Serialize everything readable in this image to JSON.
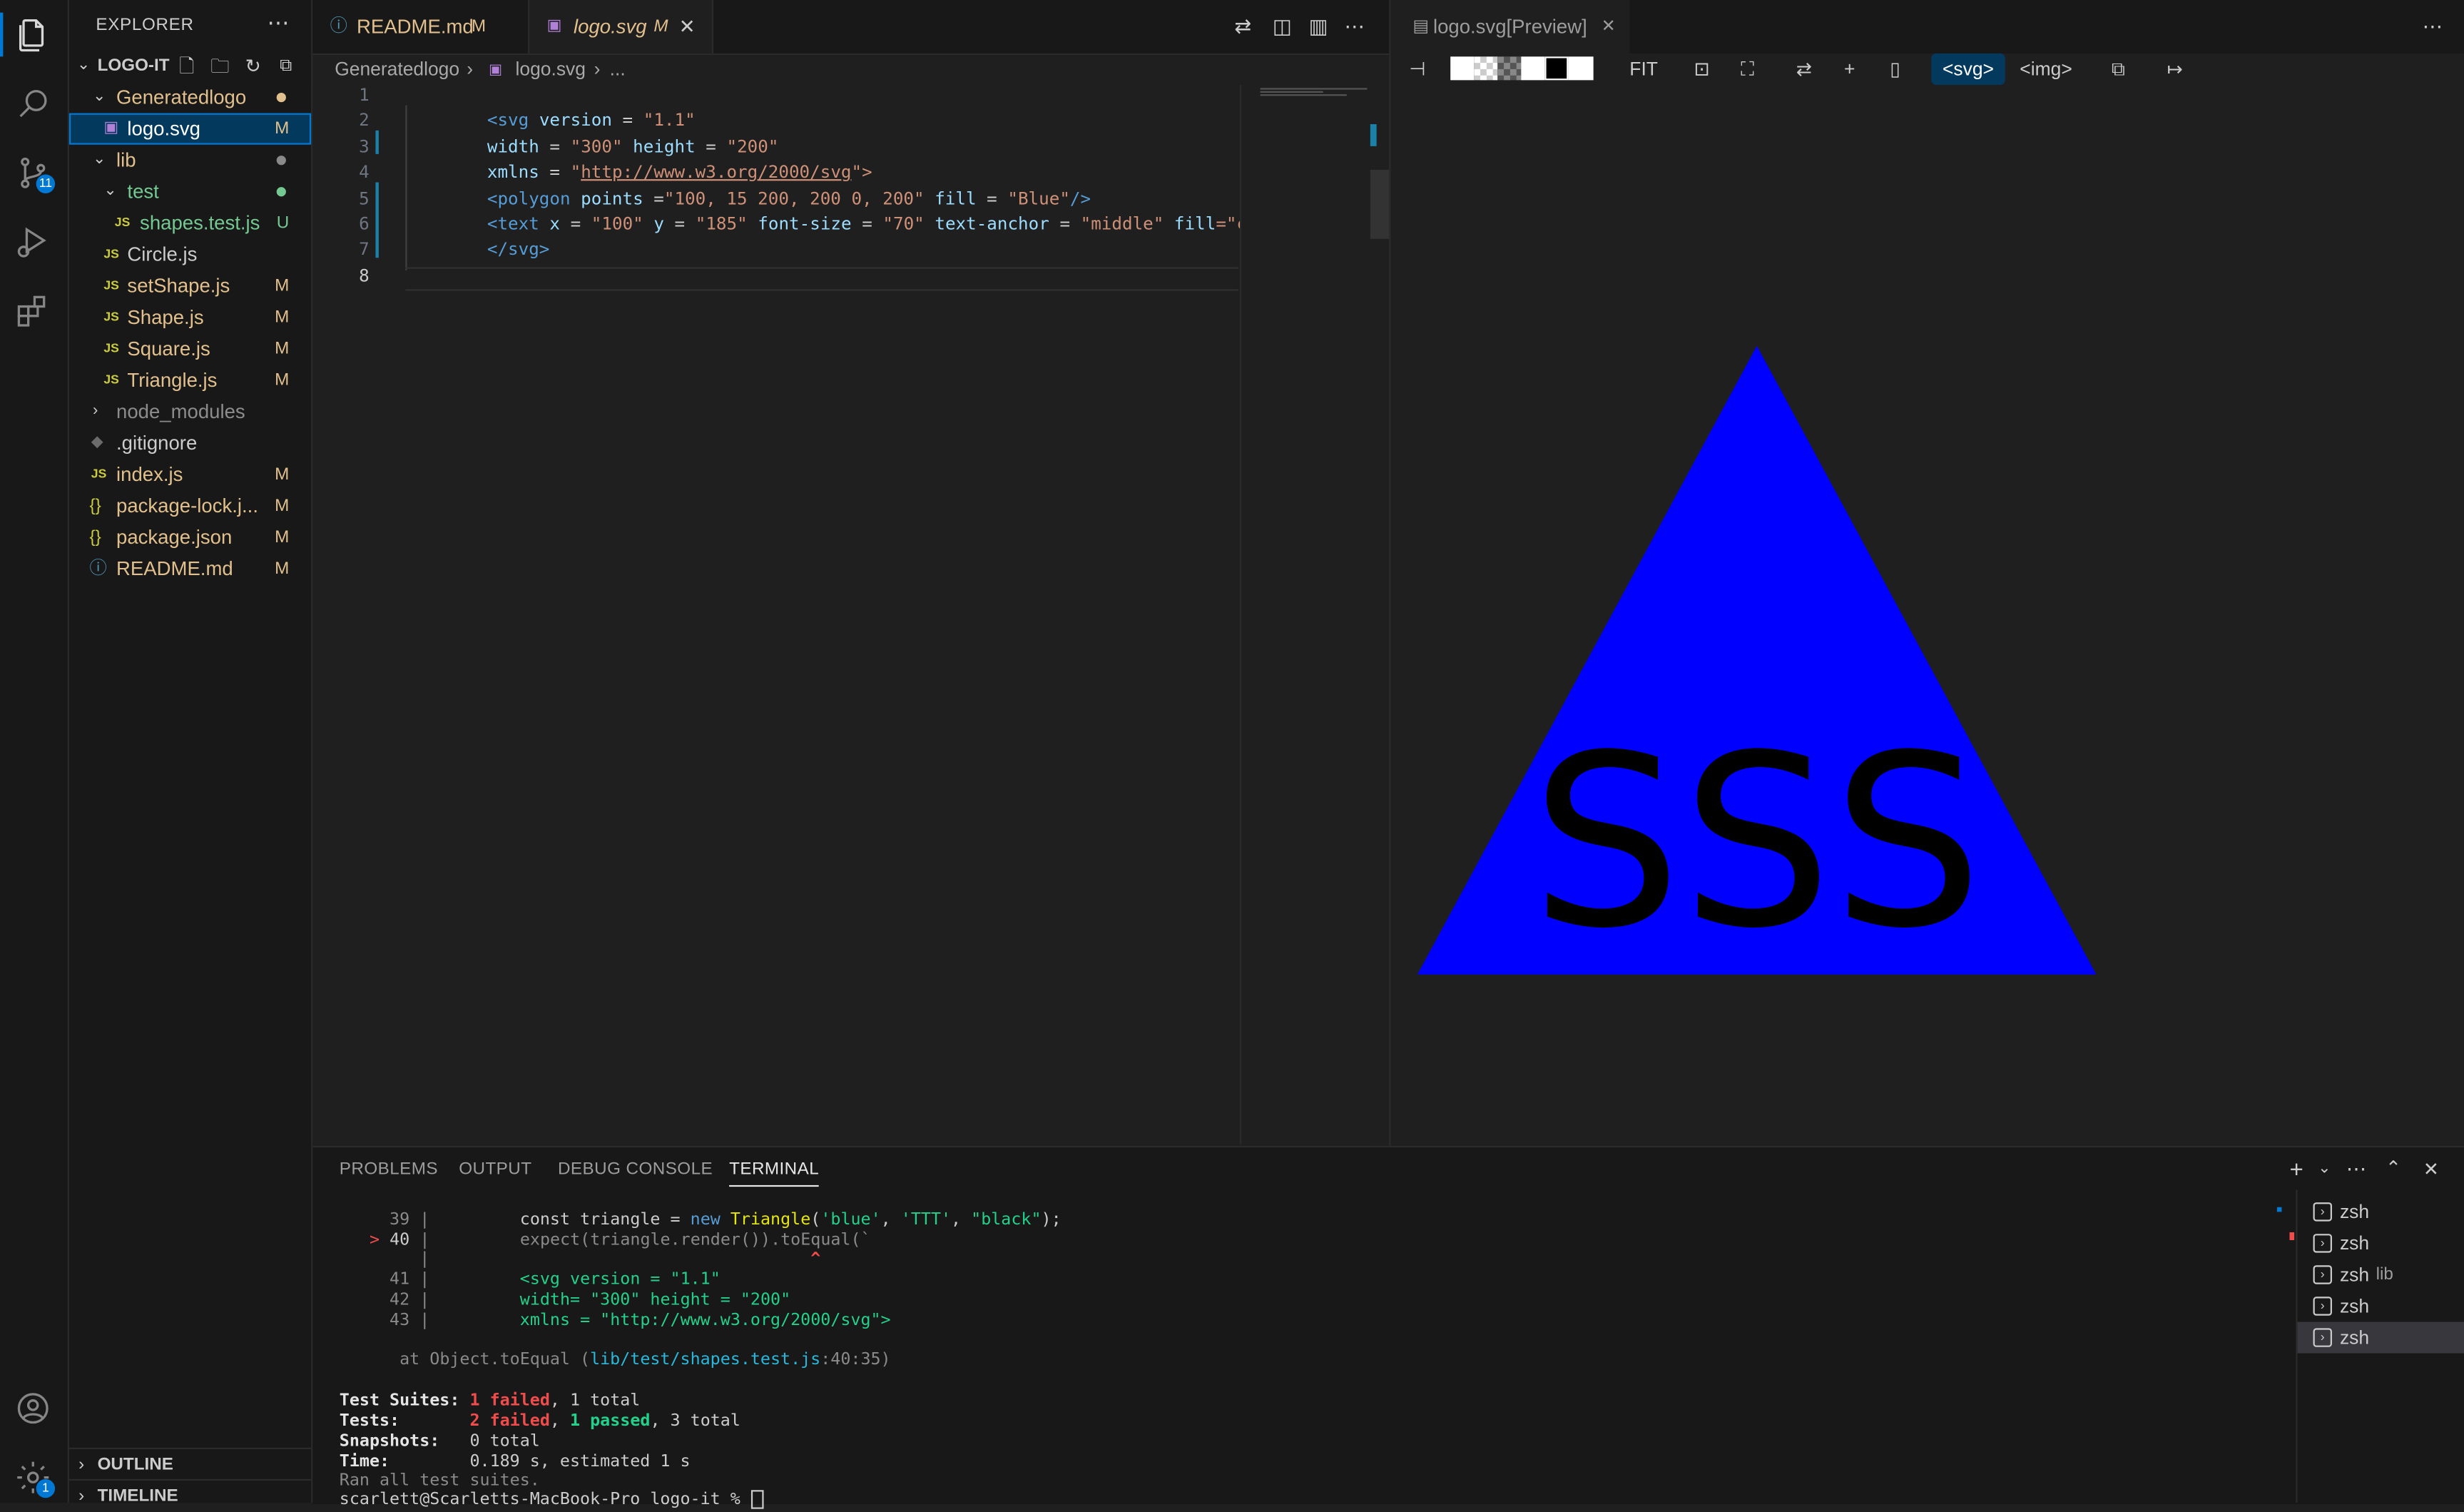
{
  "sidebar": {
    "title": "EXPLORER",
    "root": "LOGO-IT",
    "items": [
      {
        "label": "Generatedlogo",
        "status": ""
      },
      {
        "label": "logo.svg",
        "status": "M"
      },
      {
        "label": "lib",
        "status": ""
      },
      {
        "label": "test",
        "status": ""
      },
      {
        "label": "shapes.test.js",
        "status": "U"
      },
      {
        "label": "Circle.js",
        "status": ""
      },
      {
        "label": "setShape.js",
        "status": "M"
      },
      {
        "label": "Shape.js",
        "status": "M"
      },
      {
        "label": "Square.js",
        "status": "M"
      },
      {
        "label": "Triangle.js",
        "status": "M"
      },
      {
        "label": "node_modules",
        "status": ""
      },
      {
        "label": ".gitignore",
        "status": ""
      },
      {
        "label": "index.js",
        "status": "M"
      },
      {
        "label": "package-lock.j...",
        "status": "M"
      },
      {
        "label": "package.json",
        "status": "M"
      },
      {
        "label": "README.md",
        "status": "M"
      }
    ],
    "outline": "OUTLINE",
    "timeline": "TIMELINE"
  },
  "activity": {
    "scm_badge": "11",
    "settings_badge": "1"
  },
  "tabs": [
    {
      "label": "README.md",
      "status": "M"
    },
    {
      "label": "logo.svg",
      "status": "M"
    }
  ],
  "breadcrumb": {
    "folder": "Generatedlogo",
    "file": "logo.svg",
    "more": "..."
  },
  "editor": {
    "line_numbers": [
      "1",
      "2",
      "3",
      "4",
      "5",
      "6",
      "7",
      "8"
    ],
    "lines": [
      {
        "p1": "<svg",
        "p2": " version",
        "p3": " = ",
        "p4": "\"1.1\""
      },
      {
        "p1": "width",
        "p2": " = ",
        "p3": "\"300\"",
        "p4": " height",
        "p5": " = ",
        "p6": "\"200\""
      },
      {
        "p1": "xmlns",
        "p2": " = ",
        "p3": "\"",
        "p4": "http://www.w3.org/2000/svg",
        "p5": "\">"
      },
      {
        "p1": "<polygon",
        "p2": " points",
        "p3": " =",
        "p4": "\"100, 15 200, 200 0, 200\"",
        "p5": " fill",
        "p6": " = ",
        "p7": "\"Blue\"",
        "p8": "/>"
      },
      {
        "p1": "<text",
        "p2": " x",
        "p3": " = ",
        "p4": "\"100\"",
        "p5": " y",
        "p6": " = ",
        "p7": "\"185\"",
        "p8": " font-size",
        "p9": " = ",
        "p10": "\"70\"",
        "p11": " text-anchor",
        "p12": " = ",
        "p13": "\"middle\"",
        "p14": " fill",
        "p15": "=\"c"
      },
      {
        "p1": "</svg>"
      }
    ]
  },
  "preview": {
    "tab_label": "logo.svg[Preview]",
    "fit": "FIT",
    "svg_btn": "<svg>",
    "img_btn": "<img>",
    "shape_text": "SSS",
    "shape_fill": "#0000ff",
    "text_fill": "#000000"
  },
  "panel": {
    "tabs": [
      "PROBLEMS",
      "OUTPUT",
      "DEBUG CONSOLE",
      "TERMINAL"
    ],
    "terminal": {
      "l39_no": "39",
      "l39_a": "const triangle = ",
      "l39_b": "new ",
      "l39_c": "Triangle",
      "l39_d": "(",
      "l39_e": "'blue'",
      "l39_f": ", ",
      "l39_g": "'TTT'",
      "l39_h": ", ",
      "l39_i": "\"black\"",
      "l39_j": ");",
      "l40_mark": ">",
      "l40_no": "40",
      "l40_text": "expect(triangle.render()).toEqual(`",
      "caret": "^",
      "l41_no": "41",
      "l41_text": "<svg version = \"1.1\"",
      "l42_no": "42",
      "l42_text": "width= \"300\" height = \"200\"",
      "l43_no": "43",
      "l43_text": "xmlns = \"http://www.w3.org/2000/svg\">",
      "at_a": "at Object.toEqual (",
      "at_b": "lib/test/shapes.test.js",
      "at_c": ":40:35)",
      "suites_k": "Test Suites:",
      "suites_f": "1 failed",
      "suites_r": ", 1 total",
      "tests_k": "Tests:",
      "tests_f": "2 failed",
      "tests_m": ", ",
      "tests_p": "1 passed",
      "tests_r": ", 3 total",
      "snap_k": "Snapshots:",
      "snap_v": "0 total",
      "time_k": "Time:",
      "time_v": "0.189 s, estimated 1 s",
      "ran": "Ran all test suites.",
      "prompt": "scarlett@Scarletts-MacBook-Pro logo-it % "
    },
    "terminal_list": [
      {
        "label": "zsh",
        "sub": ""
      },
      {
        "label": "zsh",
        "sub": ""
      },
      {
        "label": "zsh",
        "sub": "lib"
      },
      {
        "label": "zsh",
        "sub": ""
      },
      {
        "label": "zsh",
        "sub": ""
      }
    ]
  }
}
